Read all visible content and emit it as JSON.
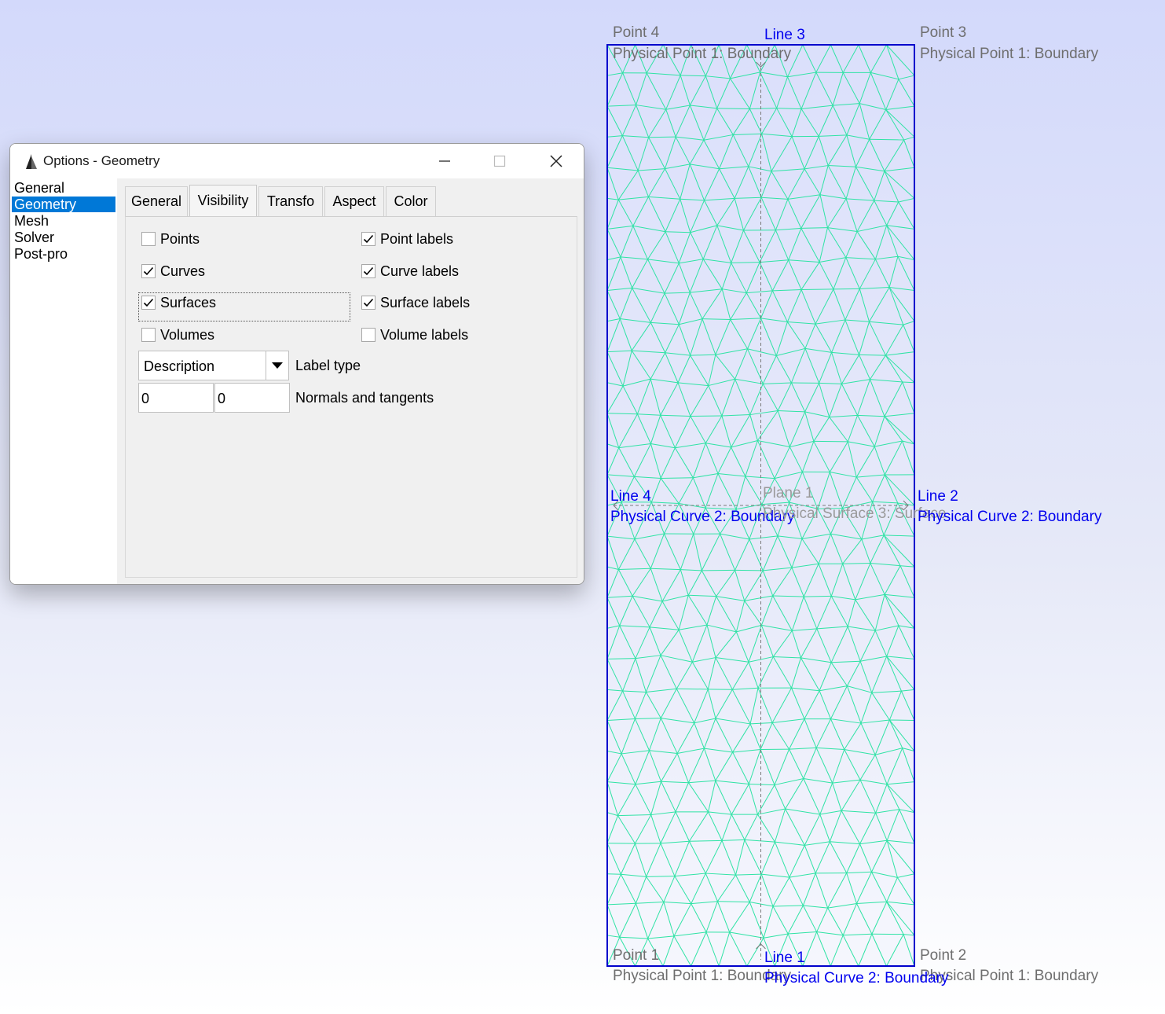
{
  "viewport": {
    "points": [
      {
        "name": "Point 4",
        "physical": "Physical Point 1: Boundary"
      },
      {
        "name": "Point 3",
        "physical": "Physical Point 1: Boundary"
      },
      {
        "name": "Point 1",
        "physical": "Physical Point 1: Boundary"
      },
      {
        "name": "Point 2",
        "physical": "Physical Point 1: Boundary"
      }
    ],
    "lines": [
      {
        "name": "Line 3",
        "physical": "Physical Curve 2: Boundary"
      },
      {
        "name": "Line 4",
        "physical": "Physical Curve 2: Boundary"
      },
      {
        "name": "Line 2",
        "physical": "Physical Curve 2: Boundary"
      },
      {
        "name": "Line 1",
        "physical": "Physical Curve 2: Boundary"
      }
    ],
    "surface": {
      "name": "Plane 1",
      "physical": "Physical Surface 3: Surface"
    },
    "colors": {
      "mesh": "#2fe3a5",
      "boundary": "#0000cc",
      "axis": "#7a7a7a"
    }
  },
  "dialog": {
    "title": "Options - Geometry",
    "nav": [
      "General",
      "Geometry",
      "Mesh",
      "Solver",
      "Post-pro"
    ],
    "nav_selected": "Geometry",
    "tabs": [
      "General",
      "Visibility",
      "Transfo",
      "Aspect",
      "Color"
    ],
    "active_tab": "Visibility",
    "checkboxes": {
      "points": {
        "label": "Points",
        "checked": false
      },
      "point_labels": {
        "label": "Point labels",
        "checked": true
      },
      "curves": {
        "label": "Curves",
        "checked": true
      },
      "curve_labels": {
        "label": "Curve labels",
        "checked": true
      },
      "surfaces": {
        "label": "Surfaces",
        "checked": true
      },
      "surface_labels": {
        "label": "Surface labels",
        "checked": true
      },
      "volumes": {
        "label": "Volumes",
        "checked": false
      },
      "volume_labels": {
        "label": "Volume labels",
        "checked": false
      }
    },
    "label_type": {
      "value": "Description",
      "label": "Label type"
    },
    "normals": {
      "value1": "0",
      "value2": "0",
      "label": "Normals and tangents"
    },
    "accent_color": "#0078d7"
  }
}
